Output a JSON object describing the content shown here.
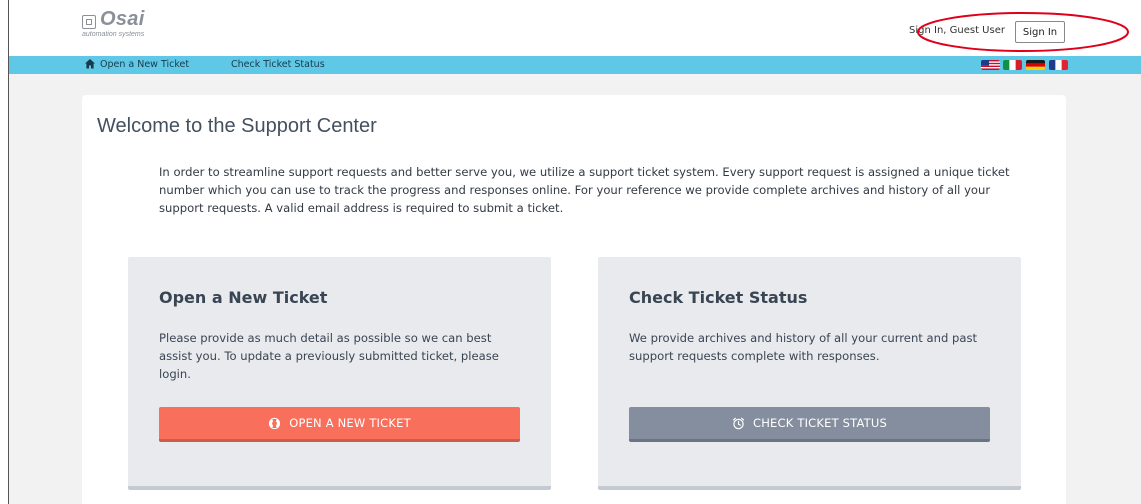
{
  "logo": {
    "name": "Osai",
    "tagline": "automation systems"
  },
  "header": {
    "signin_text": "Sign In, Guest User",
    "signin_button": "Sign In"
  },
  "nav": {
    "links": [
      "Open a New Ticket",
      "Check Ticket Status"
    ],
    "flags": [
      "us-flag",
      "it-flag",
      "de-flag",
      "fr-flag"
    ]
  },
  "main": {
    "title": "Welcome to the Support Center",
    "intro": "In order to streamline support requests and better serve you, we utilize a support ticket system. Every support request is assigned a unique ticket number which you can use to track the progress and responses online. For your reference we provide complete archives and history of all your support requests. A valid email address is required to submit a ticket.",
    "panels": [
      {
        "title": "Open a New Ticket",
        "text": "Please provide as much detail as possible so we can best assist you. To update a previously submitted ticket, please login.",
        "button": "OPEN A NEW TICKET",
        "icon": "lifebuoy-icon"
      },
      {
        "title": "Check Ticket Status",
        "text": "We provide archives and history of all your current and past support requests complete with responses.",
        "button": "CHECK TICKET STATUS",
        "icon": "alarm-clock-icon"
      }
    ]
  },
  "colors": {
    "nav_bar": "#5fc8e6",
    "open_button": "#f86f5b",
    "status_button": "#858e9e",
    "annotation": "#e0001b"
  }
}
